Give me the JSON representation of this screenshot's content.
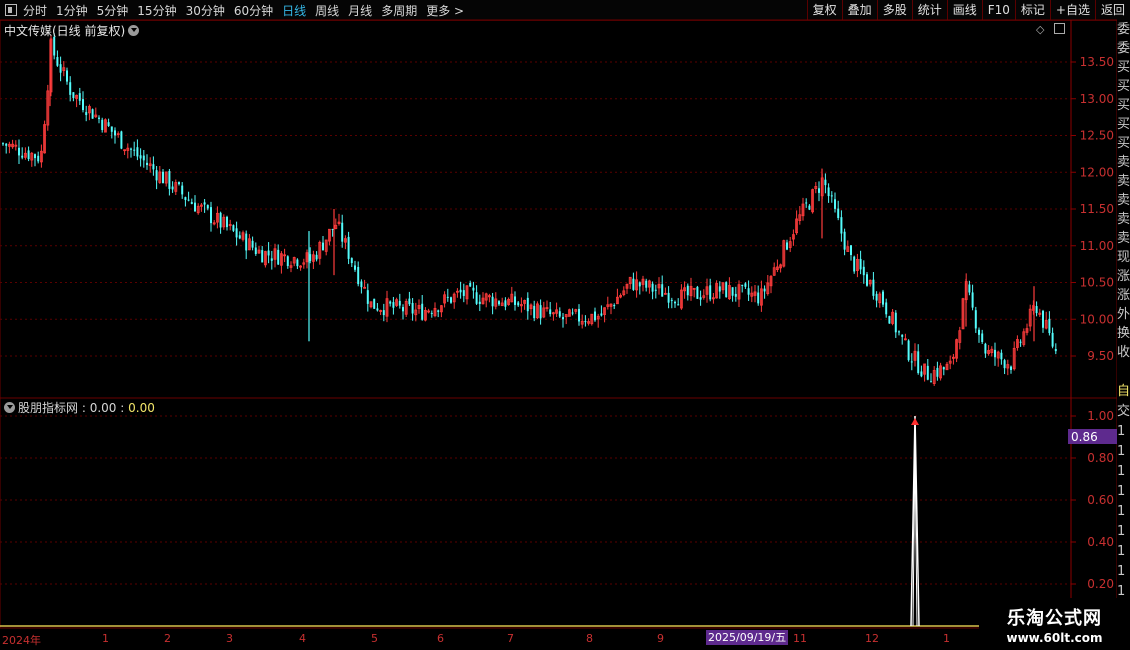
{
  "toolbar": {
    "periods": [
      "分时",
      "1分钟",
      "5分钟",
      "15分钟",
      "30分钟",
      "60分钟",
      "日线",
      "周线",
      "月线",
      "多周期",
      "更多 >"
    ],
    "active_period": "日线",
    "right_buttons": [
      "复权",
      "叠加",
      "多股",
      "统计",
      "画线",
      "F10",
      "标记",
      "+自选",
      "返回"
    ]
  },
  "main_pane": {
    "title": "中文传媒(日线 前复权)",
    "y_ticks": [
      "13.50",
      "13.00",
      "12.50",
      "12.00",
      "11.50",
      "11.00",
      "10.50",
      "10.00",
      "9.50"
    ]
  },
  "indicator_pane": {
    "name": "股朋指标网",
    "sep": ":",
    "value1": "0.00",
    "value2": "0.00",
    "y_ticks": [
      "1.00",
      "0.80",
      "0.60",
      "0.40",
      "0.20"
    ],
    "current_badge": "0.86"
  },
  "x_axis": {
    "labels": [
      "2024年",
      "1",
      "2",
      "3",
      "4",
      "5",
      "6",
      "7",
      "8",
      "9",
      "11",
      "12",
      "1"
    ],
    "cursor_date": "2025/09/19/五"
  },
  "side_panel": {
    "chars": [
      "委",
      "委",
      "买",
      "买",
      "买",
      "买",
      "买",
      "卖",
      "卖",
      "卖",
      "卖",
      "卖",
      "现",
      "涨",
      "涨",
      "外",
      "换",
      "收"
    ],
    "ind_chars": [
      "自",
      "交",
      "1",
      "1",
      "1",
      "1",
      "1",
      "1",
      "1",
      "1",
      "1"
    ]
  },
  "watermark": {
    "title": "乐淘公式网",
    "url": "www.60lt.com"
  },
  "colors": {
    "up": "#ff3c3c",
    "down": "#54fcfc",
    "axis_label": "#cc2a2a",
    "grid": "#5a0000",
    "active": "#35b8e8",
    "signal": "#ffffff",
    "arrow": "#ff3030"
  },
  "chart_data": [
    {
      "type": "candlestick",
      "title": "中文传媒(日线 前复权)",
      "ylim": [
        9.2,
        13.85
      ],
      "approx_close_path": [
        {
          "x": "2024年",
          "y": 12.3
        },
        {
          "x": "1",
          "y": 12.6
        },
        {
          "x": "2",
          "y": 11.5
        },
        {
          "x": "3",
          "y": 10.9
        },
        {
          "x": "4",
          "y": 10.8
        },
        {
          "x": "5",
          "y": 10.2
        },
        {
          "x": "6",
          "y": 10.35
        },
        {
          "x": "7",
          "y": 10.1
        },
        {
          "x": "8",
          "y": 10.4
        },
        {
          "x": "9",
          "y": 10.35
        },
        {
          "x": "11",
          "y": 11.6
        },
        {
          "x": "12",
          "y": 10.0
        },
        {
          "x": "1",
          "y": 9.5
        }
      ],
      "extremes": {
        "high": 13.8,
        "low": 9.22
      }
    },
    {
      "type": "line",
      "series": [
        {
          "name": "股朋指标网",
          "values": [
            0.0,
            0.0,
            1.0,
            0.0
          ]
        }
      ],
      "ylim": [
        0,
        1.05
      ],
      "signal_date": "2025/09/19/五",
      "signal_value": 1.0
    }
  ]
}
